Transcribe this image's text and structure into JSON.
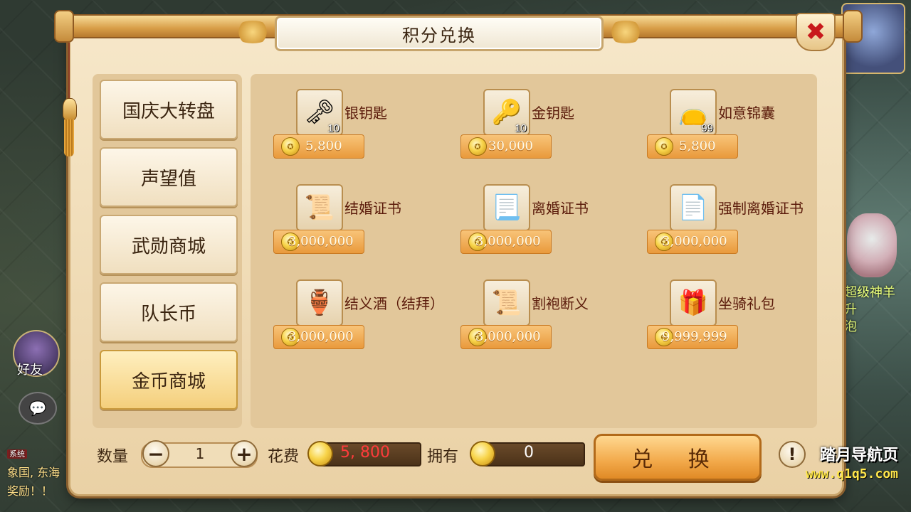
{
  "dialog": {
    "title": "积分兑换",
    "close_icon": "✖"
  },
  "tabs": [
    {
      "label": "国庆大转盘",
      "active": false
    },
    {
      "label": "声望值",
      "active": false
    },
    {
      "label": "武勋商城",
      "active": false
    },
    {
      "label": "队长币",
      "active": false
    },
    {
      "label": "金币商城",
      "active": true
    }
  ],
  "items": [
    {
      "name": "银钥匙",
      "price": "5,800",
      "count": "10",
      "icon": "silver-key-icon",
      "glyph": "🗝"
    },
    {
      "name": "金钥匙",
      "price": "30,000",
      "count": "10",
      "icon": "gold-key-icon",
      "glyph": "🔑"
    },
    {
      "name": "如意锦囊",
      "price": "5,800",
      "count": "99",
      "icon": "brocade-bag-icon",
      "glyph": "👝"
    },
    {
      "name": "结婚证书",
      "price": "3,000,000",
      "count": "",
      "icon": "marriage-scroll-icon",
      "glyph": "📜"
    },
    {
      "name": "离婚证书",
      "price": "3,000,000",
      "count": "",
      "icon": "divorce-scroll-icon",
      "glyph": "📃"
    },
    {
      "name": "强制离婚证书",
      "price": "3,000,000",
      "count": "",
      "icon": "forced-divorce-paper-icon",
      "glyph": "📄"
    },
    {
      "name": "结义酒（结拜）",
      "price": "3,000,000",
      "count": "",
      "icon": "wine-jar-icon",
      "glyph": "🏺"
    },
    {
      "name": "割袍断义",
      "price": "3,000,000",
      "count": "",
      "icon": "torn-scroll-icon",
      "glyph": "📜"
    },
    {
      "name": "坐骑礼包",
      "price": "9,999,999",
      "count": "",
      "icon": "mount-gift-pack-icon",
      "glyph": "🎁"
    }
  ],
  "bottom": {
    "qty_label": "数量",
    "qty_value": "1",
    "minus": "−",
    "plus": "+",
    "cost_label": "花费",
    "cost_value": "5, 800",
    "own_label": "拥有",
    "own_value": "0",
    "exchange_label": "兑 换",
    "help": "!"
  },
  "hud": {
    "friend_label": "好友",
    "chat_system_tag": "系统",
    "chat_line_1": "象国, 东海",
    "chat_line_2": "奖励！！",
    "right_hint_1": "超级神羊",
    "right_hint_2": "升",
    "right_hint_3": "泡",
    "watermark_title": "踏月导航页",
    "watermark_url": "www.q1q5.com"
  },
  "colors": {
    "panel": "#e2c79a",
    "price_bar": "#f2a94a",
    "cost_text": "#ff3b3b",
    "own_text": "#ffffff"
  }
}
